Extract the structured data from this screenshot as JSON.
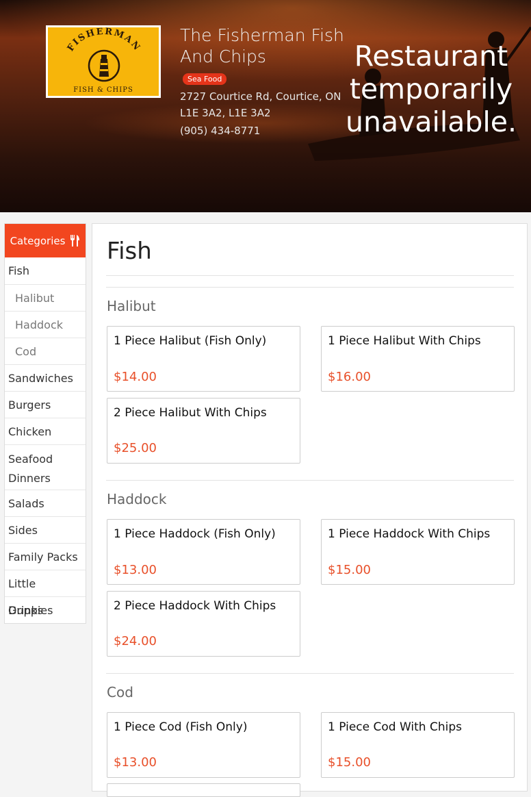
{
  "header": {
    "logo": {
      "arc_text": "FISHERMAN",
      "sub_text": "FISH & CHIPS",
      "color": "#f7b50a"
    },
    "restaurant_name": "The Fisherman Fish And Chips",
    "badge": "Sea Food",
    "address": "2727 Courtice Rd, Courtice, ON L1E 3A2, L1E 3A2",
    "phone": "(905) 434-8771",
    "status": "Restaurant temporarily unavailable."
  },
  "sidebar": {
    "title": "Categories",
    "items": [
      {
        "label": "Fish"
      },
      {
        "label": "Halibut"
      },
      {
        "label": "Haddock"
      },
      {
        "label": "Cod"
      },
      {
        "label": "Sandwiches"
      },
      {
        "label": "Burgers"
      },
      {
        "label": "Chicken"
      },
      {
        "label": "Seafood Dinners"
      },
      {
        "label": "Salads"
      },
      {
        "label": "Sides"
      },
      {
        "label": "Family Packs"
      },
      {
        "label": "Little Guppies"
      },
      {
        "label": "Drinks"
      }
    ]
  },
  "main": {
    "title": "Fish",
    "sections": [
      {
        "title": "Halibut",
        "items": [
          {
            "name": "1 Piece Halibut (Fish Only)",
            "price": "$14.00"
          },
          {
            "name": "1 Piece Halibut With Chips",
            "price": "$16.00"
          },
          {
            "name": "2 Piece Halibut With Chips",
            "price": "$25.00"
          }
        ]
      },
      {
        "title": "Haddock",
        "items": [
          {
            "name": "1 Piece Haddock (Fish Only)",
            "price": "$13.00"
          },
          {
            "name": "1 Piece Haddock With Chips",
            "price": "$15.00"
          },
          {
            "name": "2 Piece Haddock With Chips",
            "price": "$24.00"
          }
        ]
      },
      {
        "title": "Cod",
        "items": [
          {
            "name": "1 Piece Cod (Fish Only)",
            "price": "$13.00"
          },
          {
            "name": "1 Piece Cod With Chips",
            "price": "$15.00"
          }
        ]
      }
    ]
  },
  "colors": {
    "accent": "#f2461f",
    "price": "#e8502a",
    "badge": "#e5341a"
  }
}
